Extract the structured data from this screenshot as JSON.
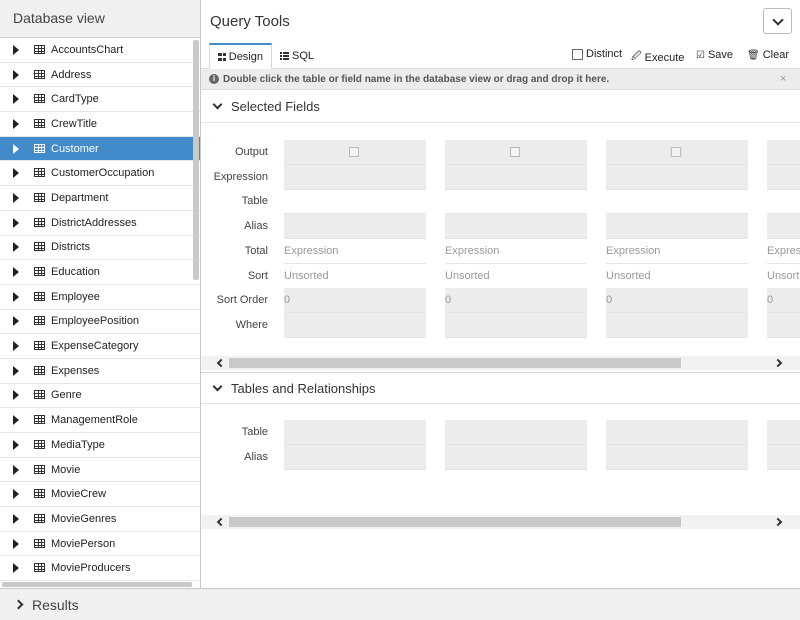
{
  "left_panel": {
    "title": "Database view",
    "items": [
      {
        "label": "AccountsChart",
        "selected": false
      },
      {
        "label": "Address",
        "selected": false
      },
      {
        "label": "CardType",
        "selected": false
      },
      {
        "label": "CrewTitle",
        "selected": false
      },
      {
        "label": "Customer",
        "selected": true
      },
      {
        "label": "CustomerOccupation",
        "selected": false
      },
      {
        "label": "Department",
        "selected": false
      },
      {
        "label": "DistrictAddresses",
        "selected": false
      },
      {
        "label": "Districts",
        "selected": false
      },
      {
        "label": "Education",
        "selected": false
      },
      {
        "label": "Employee",
        "selected": false
      },
      {
        "label": "EmployeePosition",
        "selected": false
      },
      {
        "label": "ExpenseCategory",
        "selected": false
      },
      {
        "label": "Expenses",
        "selected": false
      },
      {
        "label": "Genre",
        "selected": false
      },
      {
        "label": "ManagementRole",
        "selected": false
      },
      {
        "label": "MediaType",
        "selected": false
      },
      {
        "label": "Movie",
        "selected": false
      },
      {
        "label": "MovieCrew",
        "selected": false
      },
      {
        "label": "MovieGenres",
        "selected": false
      },
      {
        "label": "MoviePerson",
        "selected": false
      },
      {
        "label": "MovieProducers",
        "selected": false
      }
    ]
  },
  "query_tools": {
    "title": "Query Tools",
    "tabs": [
      {
        "label": "Design",
        "icon": "grid-icon",
        "active": true
      },
      {
        "label": "SQL",
        "icon": "list-icon",
        "active": false
      }
    ],
    "actions": {
      "distinct_label": "Distinct",
      "distinct_checked": false,
      "execute_label": "Execute",
      "save_label": "Save",
      "clear_label": "Clear"
    },
    "info_message": "Double click the table or field name in the database view or drag and drop it here.",
    "info_close": "×"
  },
  "selected_fields": {
    "title": "Selected Fields",
    "row_labels": [
      "Output",
      "Expression",
      "Table",
      "Alias",
      "Total",
      "Sort",
      "Sort Order",
      "Where"
    ],
    "columns": [
      {
        "output_checked": false,
        "expression": "",
        "table": "",
        "alias": "",
        "total": "Expression",
        "sort": "Unsorted",
        "sort_order": "0",
        "where": ""
      },
      {
        "output_checked": false,
        "expression": "",
        "table": "",
        "alias": "",
        "total": "Expression",
        "sort": "Unsorted",
        "sort_order": "0",
        "where": ""
      },
      {
        "output_checked": false,
        "expression": "",
        "table": "",
        "alias": "",
        "total": "Expression",
        "sort": "Unsorted",
        "sort_order": "0",
        "where": ""
      },
      {
        "output_checked": false,
        "expression": "",
        "table": "",
        "alias": "",
        "total": "Expres",
        "sort": "Unsort",
        "sort_order": "0",
        "where": ""
      }
    ]
  },
  "tables_relationships": {
    "title": "Tables and Relationships",
    "row_labels": [
      "Table",
      "Alias"
    ],
    "columns": [
      {
        "table": "",
        "alias": ""
      },
      {
        "table": "",
        "alias": ""
      },
      {
        "table": "",
        "alias": ""
      },
      {
        "table": "",
        "alias": ""
      }
    ]
  },
  "results": {
    "title": "Results"
  },
  "colors": {
    "selected_bg": "#428bca",
    "active_tab_accent": "#428bca",
    "cell_bg": "#ececec"
  }
}
